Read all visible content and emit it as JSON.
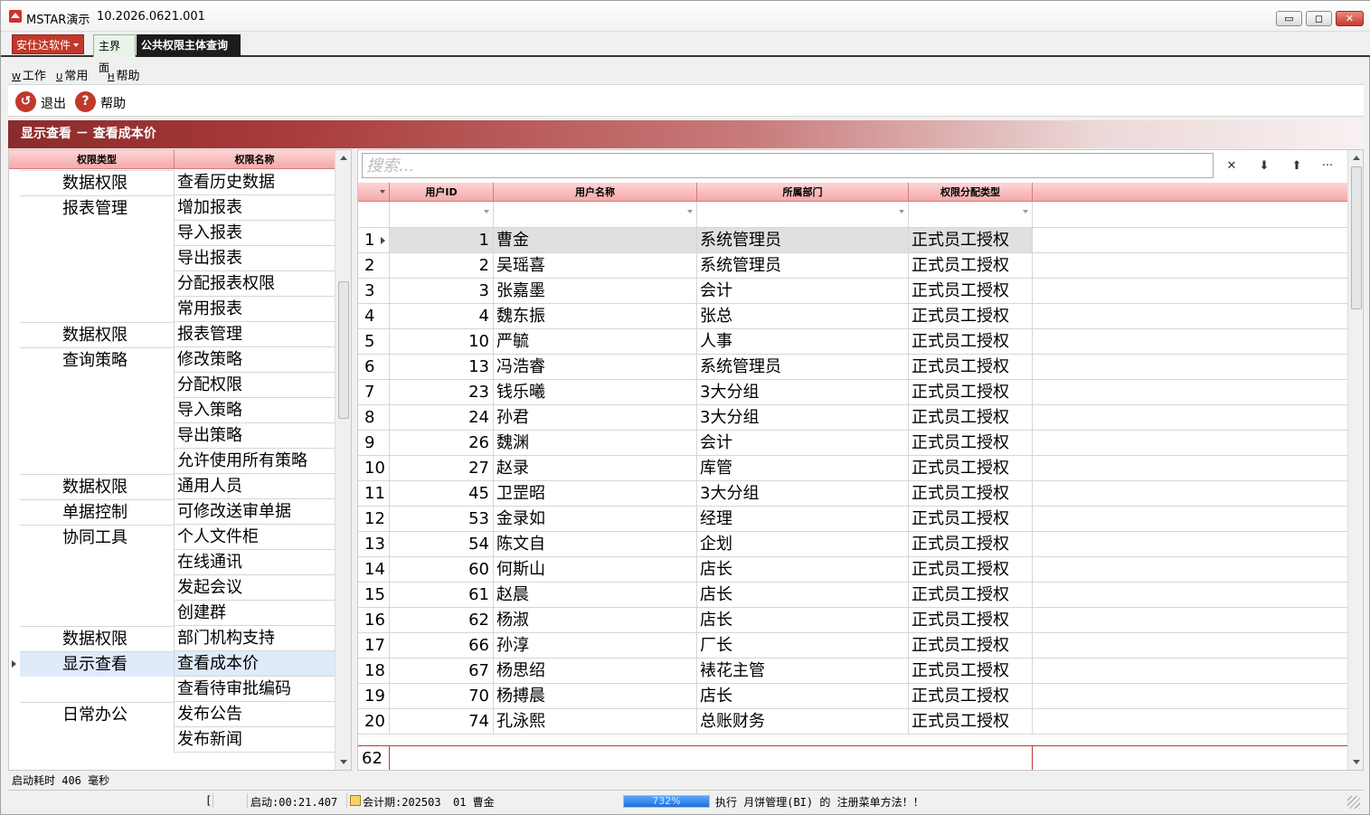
{
  "window": {
    "app_name": "MSTAR演示",
    "version": "10.2026.0621.001",
    "min_glyph": "▭",
    "max_glyph": "◻",
    "close_glyph": "✕"
  },
  "tabs": {
    "brand": "安仕达软件",
    "home": "主界面",
    "active": "公共权限主体查询"
  },
  "menu": {
    "items": [
      {
        "key": "W",
        "label": "工作"
      },
      {
        "key": "U",
        "label": "常用"
      },
      {
        "key": "H",
        "label": "帮助"
      }
    ]
  },
  "toolbar": {
    "exit_label": "退出",
    "help_label": "帮助",
    "help_glyph": "?"
  },
  "section": {
    "title": "显示查看 － 查看成本价"
  },
  "left_table": {
    "columns": [
      "权限类型",
      "权限名称"
    ],
    "rows": [
      {
        "type": "数据权限",
        "name": "查看历史数据"
      },
      {
        "type": "报表管理",
        "name": "增加报表"
      },
      {
        "type": "",
        "name": "导入报表"
      },
      {
        "type": "",
        "name": "导出报表"
      },
      {
        "type": "",
        "name": "分配报表权限"
      },
      {
        "type": "",
        "name": "常用报表"
      },
      {
        "type": "数据权限",
        "name": "报表管理"
      },
      {
        "type": "查询策略",
        "name": "修改策略"
      },
      {
        "type": "",
        "name": "分配权限"
      },
      {
        "type": "",
        "name": "导入策略"
      },
      {
        "type": "",
        "name": "导出策略"
      },
      {
        "type": "",
        "name": "允许使用所有策略"
      },
      {
        "type": "数据权限",
        "name": "通用人员"
      },
      {
        "type": "单据控制",
        "name": "可修改送审单据"
      },
      {
        "type": "协同工具",
        "name": "个人文件柜"
      },
      {
        "type": "",
        "name": "在线通讯"
      },
      {
        "type": "",
        "name": "发起会议"
      },
      {
        "type": "",
        "name": "创建群"
      },
      {
        "type": "数据权限",
        "name": "部门机构支持"
      },
      {
        "type": "显示查看",
        "name": "查看成本价"
      },
      {
        "type": "",
        "name": "查看待审批编码"
      },
      {
        "type": "日常办公",
        "name": "发布公告"
      },
      {
        "type": "",
        "name": "发布新闻"
      }
    ]
  },
  "search": {
    "placeholder": "搜索...",
    "clear_glyph": "✕",
    "down_glyph": "⬇",
    "up_glyph": "⬆",
    "more_glyph": "···"
  },
  "user_table": {
    "columns": [
      "用户ID",
      "用户名称",
      "所属部门",
      "权限分配类型"
    ],
    "rows": [
      {
        "n": "1",
        "id": "1",
        "name": "曹金",
        "dept": "系统管理员",
        "type": "正式员工授权"
      },
      {
        "n": "2",
        "id": "2",
        "name": "吴瑶喜",
        "dept": "系统管理员",
        "type": "正式员工授权"
      },
      {
        "n": "3",
        "id": "3",
        "name": "张嘉墨",
        "dept": "会计",
        "type": "正式员工授权"
      },
      {
        "n": "4",
        "id": "4",
        "name": "魏东振",
        "dept": "张总",
        "type": "正式员工授权"
      },
      {
        "n": "5",
        "id": "10",
        "name": "严毓",
        "dept": "人事",
        "type": "正式员工授权"
      },
      {
        "n": "6",
        "id": "13",
        "name": "冯浩睿",
        "dept": "系统管理员",
        "type": "正式员工授权"
      },
      {
        "n": "7",
        "id": "23",
        "name": "钱乐曦",
        "dept": "3大分组",
        "type": "正式员工授权"
      },
      {
        "n": "8",
        "id": "24",
        "name": "孙君",
        "dept": "3大分组",
        "type": "正式员工授权"
      },
      {
        "n": "9",
        "id": "26",
        "name": "魏渊",
        "dept": "会计",
        "type": "正式员工授权"
      },
      {
        "n": "10",
        "id": "27",
        "name": "赵录",
        "dept": "库管",
        "type": "正式员工授权"
      },
      {
        "n": "11",
        "id": "45",
        "name": "卫罡昭",
        "dept": "3大分组",
        "type": "正式员工授权"
      },
      {
        "n": "12",
        "id": "53",
        "name": "金录如",
        "dept": "经理",
        "type": "正式员工授权"
      },
      {
        "n": "13",
        "id": "54",
        "name": "陈文自",
        "dept": "企划",
        "type": "正式员工授权"
      },
      {
        "n": "14",
        "id": "60",
        "name": "何斯山",
        "dept": "店长",
        "type": "正式员工授权"
      },
      {
        "n": "15",
        "id": "61",
        "name": "赵晨",
        "dept": "店长",
        "type": "正式员工授权"
      },
      {
        "n": "16",
        "id": "62",
        "name": "杨淑",
        "dept": "店长",
        "type": "正式员工授权"
      },
      {
        "n": "17",
        "id": "66",
        "name": "孙淳",
        "dept": "厂长",
        "type": "正式员工授权"
      },
      {
        "n": "18",
        "id": "67",
        "name": "杨思绍",
        "dept": "裱花主管",
        "type": "正式员工授权"
      },
      {
        "n": "19",
        "id": "70",
        "name": "杨搏晨",
        "dept": "店长",
        "type": "正式员工授权"
      },
      {
        "n": "20",
        "id": "74",
        "name": "孔泳熙",
        "dept": "总账财务",
        "type": "正式员工授权"
      }
    ],
    "total_count": "62"
  },
  "status": {
    "startup_time": "启动耗时 406 毫秒",
    "marker": "[",
    "uptime": "启动:00:21.407",
    "period": "会计期:202503",
    "user": "01 曹金",
    "progress_text": "732%",
    "progress_fraction": 1.0,
    "message": "执行 月饼管理(BI) 的 注册菜单方法！！"
  }
}
